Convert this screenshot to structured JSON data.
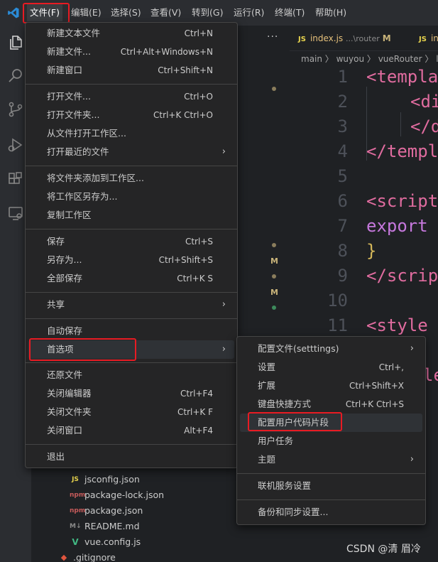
{
  "menubar": {
    "items": [
      "文件(F)",
      "编辑(E)",
      "选择(S)",
      "查看(V)",
      "转到(G)",
      "运行(R)",
      "终端(T)",
      "帮助(H)"
    ]
  },
  "file_menu": {
    "items": [
      {
        "label": "新建文本文件",
        "key": "Ctrl+N"
      },
      {
        "label": "新建文件...",
        "key": "Ctrl+Alt+Windows+N"
      },
      {
        "label": "新建窗口",
        "key": "Ctrl+Shift+N"
      },
      {
        "label": "打开文件...",
        "key": "Ctrl+O"
      },
      {
        "label": "打开文件夹...",
        "key": "Ctrl+K Ctrl+O"
      },
      {
        "label": "从文件打开工作区...",
        "key": ""
      },
      {
        "label": "打开最近的文件",
        "key": ""
      },
      {
        "label": "将文件夹添加到工作区...",
        "key": ""
      },
      {
        "label": "将工作区另存为...",
        "key": ""
      },
      {
        "label": "复制工作区",
        "key": ""
      },
      {
        "label": "保存",
        "key": "Ctrl+S"
      },
      {
        "label": "另存为...",
        "key": "Ctrl+Shift+S"
      },
      {
        "label": "全部保存",
        "key": "Ctrl+K S"
      },
      {
        "label": "共享",
        "key": ""
      },
      {
        "label": "自动保存",
        "key": ""
      },
      {
        "label": "首选项",
        "key": ""
      },
      {
        "label": "还原文件",
        "key": ""
      },
      {
        "label": "关闭编辑器",
        "key": "Ctrl+F4"
      },
      {
        "label": "关闭文件夹",
        "key": "Ctrl+K F"
      },
      {
        "label": "关闭窗口",
        "key": "Alt+F4"
      },
      {
        "label": "退出",
        "key": ""
      }
    ]
  },
  "prefs_menu": {
    "items": [
      {
        "label": "配置文件(setttings)",
        "key": ""
      },
      {
        "label": "设置",
        "key": "Ctrl+,"
      },
      {
        "label": "扩展",
        "key": "Ctrl+Shift+X"
      },
      {
        "label": "键盘快捷方式",
        "key": "Ctrl+K Ctrl+S"
      },
      {
        "label": "配置用户代码片段",
        "key": ""
      },
      {
        "label": "用户任务",
        "key": ""
      },
      {
        "label": "主题",
        "key": ""
      },
      {
        "label": "联机服务设置",
        "key": ""
      },
      {
        "label": "备份和同步设置...",
        "key": ""
      }
    ]
  },
  "explorer": {
    "more": "···",
    "git_marks": [
      "M",
      "M"
    ],
    "files": [
      {
        "name": "jsconfig.json",
        "icon": "JS"
      },
      {
        "name": "package-lock.json",
        "icon": "npm"
      },
      {
        "name": "package.json",
        "icon": "npm"
      },
      {
        "name": "README.md",
        "icon": "M↓"
      },
      {
        "name": "vue.config.js",
        "icon": "V"
      },
      {
        "name": ".gitignore",
        "icon": "◆"
      }
    ]
  },
  "editor": {
    "tabs": [
      {
        "icon": "JS",
        "name": "index.js",
        "path": "...\\router",
        "mark": "M"
      },
      {
        "icon": "JS",
        "name": "in",
        "path": "",
        "mark": ""
      }
    ],
    "breadcrumb": "main 〉 wuyou 〉 vueRouter 〉 ling",
    "line_numbers": [
      "1",
      "2",
      "3",
      "4",
      "5",
      "6",
      "7",
      "8",
      "9",
      "10",
      "11"
    ],
    "code_lines": [
      "<templa",
      "<di",
      "</d",
      "</templ",
      "",
      "<script",
      "export",
      "}",
      "</scrip",
      "",
      "<style",
      "le"
    ]
  },
  "watermark": "CSDN @清 眉冷",
  "colors": {
    "highlight_box": "#e81b23",
    "menu_bg": "#252526",
    "selected_bg": "#04395e",
    "tag": "#e06c9f",
    "keyword": "#c678dd"
  }
}
